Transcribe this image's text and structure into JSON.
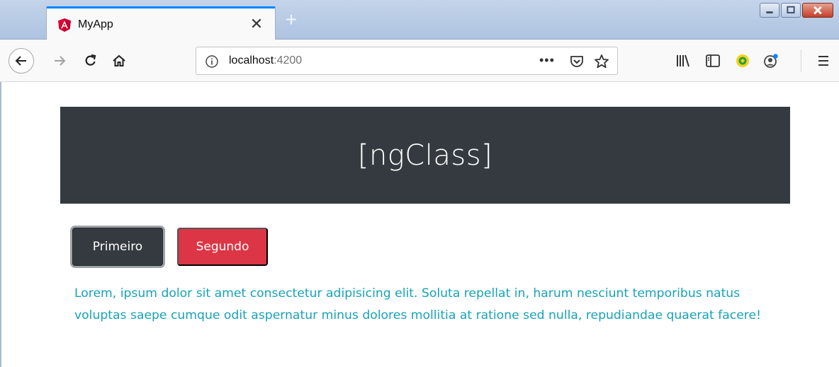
{
  "browser": {
    "tab": {
      "title": "MyApp",
      "favicon": "angular-logo-icon",
      "close_glyph": "✕"
    },
    "new_tab_glyph": "+",
    "window_controls": [
      "minimize-icon",
      "maximize-icon",
      "close-icon"
    ],
    "url": {
      "host": "localhost",
      "port": ":4200"
    },
    "url_more_glyph": "•••",
    "toolbar_icons": [
      "back-icon",
      "forward-icon",
      "reload-icon",
      "home-icon",
      "info-icon",
      "pocket-icon",
      "bookmark-star-icon",
      "library-icon",
      "sidebar-icon",
      "extension-icon",
      "account-icon",
      "menu-icon"
    ],
    "accent_color": "#0a84ff"
  },
  "page": {
    "jumbotron": {
      "title": "[ngClass]",
      "bg_color": "#343a40"
    },
    "buttons": {
      "primeiro": {
        "label": "Primeiro",
        "color": "#343a40",
        "state": "focused"
      },
      "segundo": {
        "label": "Segundo",
        "color": "#dc3545"
      }
    },
    "paragraph": {
      "text": "Lorem, ipsum dolor sit amet consectetur adipisicing elit. Soluta repellat in, harum nesciunt temporibus natus voluptas saepe cumque odit aspernatur minus dolores mollitia at ratione sed nulla, repudiandae quaerat facere!",
      "color": "#17a2b8"
    }
  }
}
